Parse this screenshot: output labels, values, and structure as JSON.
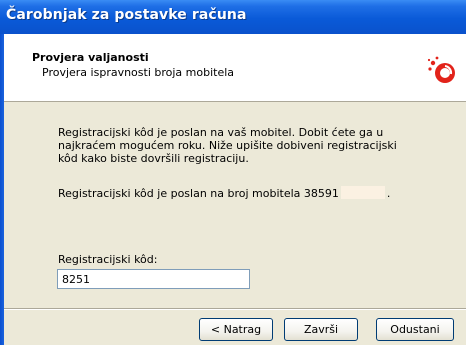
{
  "window": {
    "title": "Čarobnjak za postavke računa"
  },
  "header": {
    "title": "Provjera valjanosti",
    "subtitle": "Provjera ispravnosti broja mobitela",
    "icon": "logo-icon"
  },
  "body": {
    "paragraph": "Registracijski kôd je poslan na vaš mobitel. Dobit ćete ga u najkraćem mogućem roku. Niže upišite dobiveni registracijski kôd kako biste dovršili registraciju.",
    "phone_prefix": "Registracijski kôd je poslan na broj mobitela 38591",
    "phone_suffix": ".",
    "code_label": "Registracijski kôd:",
    "code_value": "8251"
  },
  "footer": {
    "back_label": "< Natrag",
    "finish_label": "Završi",
    "cancel_label": "Odustani"
  },
  "colors": {
    "title_bar": "#0a5ad8",
    "dialog_bg": "#ece9d8",
    "logo_red": "#e2231a"
  }
}
